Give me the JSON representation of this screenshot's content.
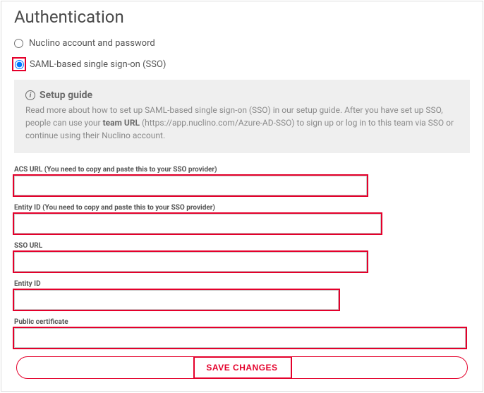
{
  "page": {
    "title": "Authentication"
  },
  "auth_options": {
    "nuclino_label": "Nuclino account and password",
    "saml_label": "SAML-based single sign-on (SSO)"
  },
  "setup": {
    "title": "Setup guide",
    "text_prefix": "Read more about how to set up SAML-based single sign-on (SSO) in our setup guide. After you have set up SSO, people can use your ",
    "team_url_label": "team URL",
    "team_url_value": " (https://app.nuclino.com/Azure-AD-SSO) ",
    "text_suffix": "to sign up or log in to this team via SSO or continue using their Nuclino account."
  },
  "fields": {
    "acs_url": {
      "label": "ACS URL (You need to copy and paste this to your SSO provider)",
      "value": ""
    },
    "entity_id_out": {
      "label": "Entity ID (You need to copy and paste this to your SSO provider)",
      "value": ""
    },
    "sso_url": {
      "label": "SSO URL",
      "value": ""
    },
    "entity_id_in": {
      "label": "Entity ID",
      "value": ""
    },
    "public_cert": {
      "label": "Public certificate",
      "value": ""
    }
  },
  "actions": {
    "save_label": "SAVE CHANGES"
  },
  "colors": {
    "accent": "#e4002b"
  }
}
